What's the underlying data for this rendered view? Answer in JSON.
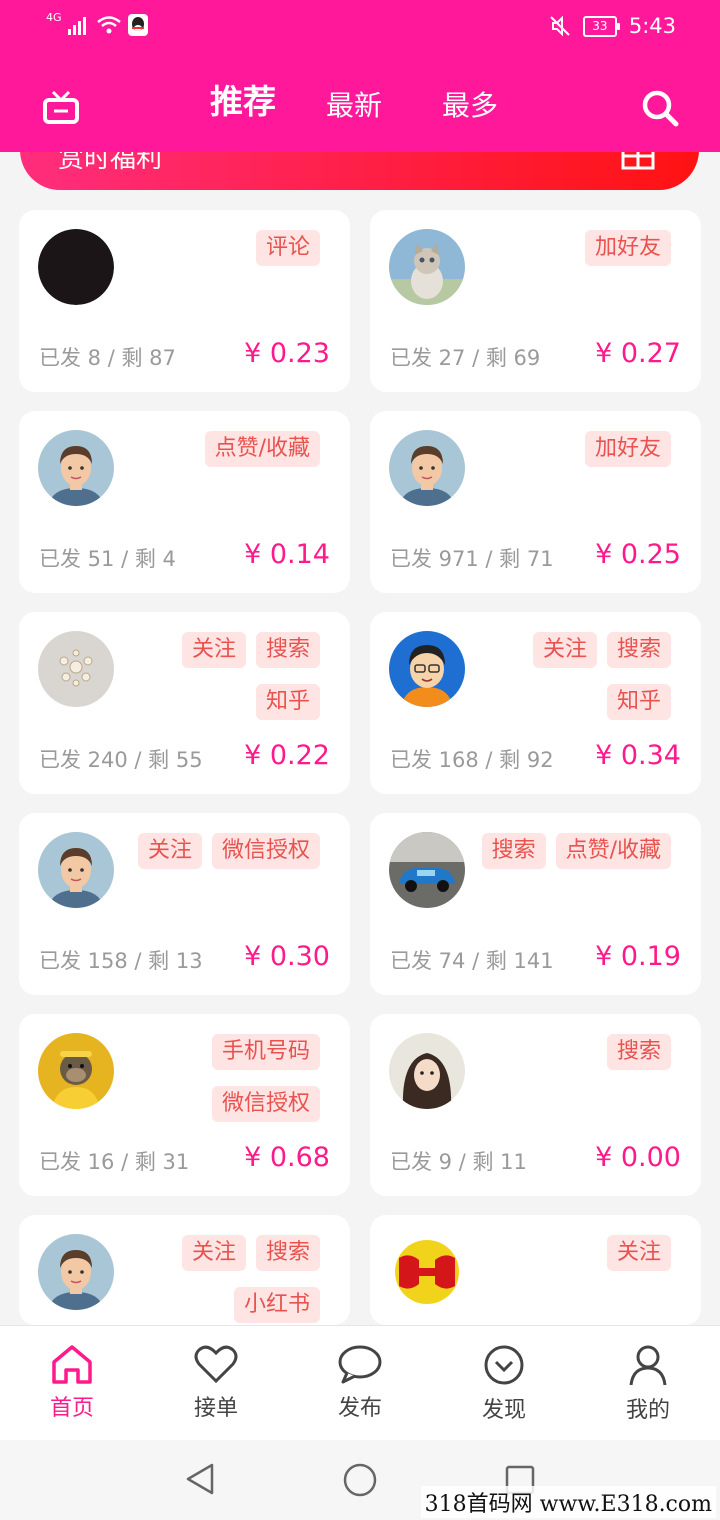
{
  "status": {
    "network": "4G",
    "battery": "33",
    "time": "5:43"
  },
  "nav": {
    "tabs": [
      {
        "label": "推荐",
        "active": true
      },
      {
        "label": "最新"
      },
      {
        "label": "最多"
      }
    ],
    "tv_icon": "tv-icon",
    "search_icon": "search-icon"
  },
  "banner": {
    "text": "赏时福利"
  },
  "cards": [
    {
      "tags": [
        "评论"
      ],
      "stats": "已发 8 / 剩 87",
      "price": "¥ 0.23",
      "avatar": "dark"
    },
    {
      "tags": [
        "加好友"
      ],
      "stats": "已发 27 / 剩 69",
      "price": "¥ 0.27",
      "avatar": "cat"
    },
    {
      "tags": [
        "点赞/收藏"
      ],
      "stats": "已发 51 / 剩 4",
      "price": "¥ 0.14",
      "avatar": "man"
    },
    {
      "tags": [
        "加好友"
      ],
      "stats": "已发 971 / 剩 71",
      "price": "¥ 0.25",
      "avatar": "man"
    },
    {
      "tags": [
        "关注",
        "搜索",
        "知乎"
      ],
      "stats": "已发 240 / 剩 55",
      "price": "¥ 0.22",
      "avatar": "jewel"
    },
    {
      "tags": [
        "关注",
        "搜索",
        "知乎"
      ],
      "stats": "已发 168 / 剩 92",
      "price": "¥ 0.34",
      "avatar": "cartoon"
    },
    {
      "tags": [
        "关注",
        "微信授权"
      ],
      "stats": "已发 158 / 剩 13",
      "price": "¥ 0.30",
      "avatar": "man"
    },
    {
      "tags": [
        "搜索",
        "点赞/收藏"
      ],
      "stats": "已发 74 / 剩 141",
      "price": "¥ 0.19",
      "avatar": "car"
    },
    {
      "tags": [
        "手机号码",
        "微信授权"
      ],
      "stats": "已发 16 / 剩 31",
      "price": "¥ 0.68",
      "avatar": "monkey"
    },
    {
      "tags": [
        "搜索"
      ],
      "stats": "已发 9 / 剩 11",
      "price": "¥ 0.00",
      "avatar": "girl"
    },
    {
      "tags": [
        "关注",
        "搜索",
        "小红书"
      ],
      "stats": "",
      "price": "",
      "avatar": "man"
    },
    {
      "tags": [
        "关注"
      ],
      "stats": "",
      "price": "",
      "avatar": "logo"
    }
  ],
  "tabbar": [
    {
      "label": "首页",
      "icon": "home-icon",
      "active": true
    },
    {
      "label": "接单",
      "icon": "heart-icon"
    },
    {
      "label": "发布",
      "icon": "chat-icon"
    },
    {
      "label": "发现",
      "icon": "discover-icon"
    },
    {
      "label": "我的",
      "icon": "profile-icon"
    }
  ],
  "colors": {
    "primary": "#ff199a",
    "price": "#ff1a8c",
    "tag_bg": "#ffe4e4",
    "tag_text": "#e8534f"
  },
  "watermark": "318首码网 www.E318.com"
}
